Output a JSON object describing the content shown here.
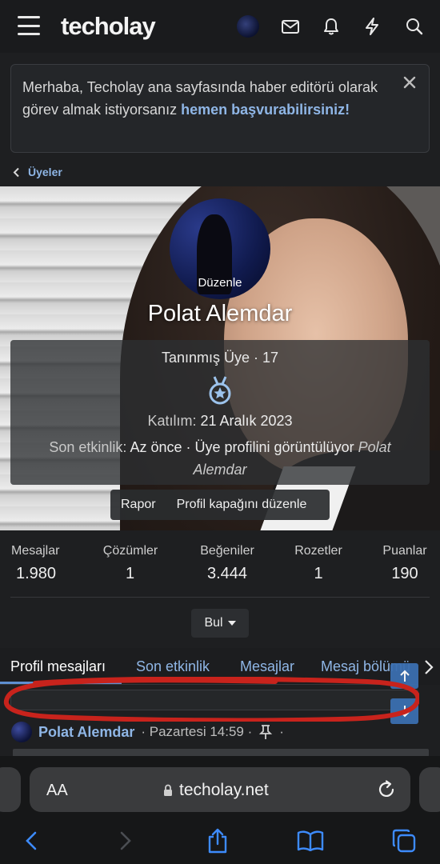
{
  "header": {
    "logo": "techolay",
    "icons": [
      "menu-icon",
      "avatar",
      "mail-icon",
      "bell-icon",
      "bolt-icon",
      "search-icon"
    ]
  },
  "notice": {
    "text": "Merhaba, Techolay ana sayfasında haber editörü olarak görev almak istiyorsanız ",
    "link": "hemen başvurabilirsiniz!"
  },
  "breadcrumb": {
    "label": "Üyeler"
  },
  "profile": {
    "avatar_edit": "Düzenle",
    "name": "Polat Alemdar",
    "title_line": "Tanınmış Üye · 17",
    "joined_label": "Katılım:",
    "joined_value": "21 Aralık 2023",
    "activity_label": "Son etkinlik:",
    "activity_value": "Az önce · Üye profilini görüntülüyor",
    "activity_target": "Polat Alemdar",
    "buttons": {
      "report": "Rapor",
      "edit_cover": "Profil kapağını düzenle"
    }
  },
  "stats": [
    {
      "label": "Mesajlar",
      "value": "1.980"
    },
    {
      "label": "Çözümler",
      "value": "1"
    },
    {
      "label": "Beğeniler",
      "value": "3.444"
    },
    {
      "label": "Rozetler",
      "value": "1"
    },
    {
      "label": "Puanlar",
      "value": "190"
    }
  ],
  "find_button": "Bul",
  "tabs": [
    {
      "label": "Profil mesajları",
      "active": true
    },
    {
      "label": "Son etkinlik",
      "active": false
    },
    {
      "label": "Mesajlar",
      "active": false
    },
    {
      "label": "Mesaj bölümü",
      "active": false
    }
  ],
  "message": {
    "author": "Polat Alemdar",
    "meta": "· Pazartesi 14:59 ·",
    "trailing": "·"
  },
  "browser": {
    "aa_label": "AA",
    "url": "techolay.net"
  },
  "colors": {
    "accent": "#8fb6e6",
    "tab_underline": "#5e8fd1",
    "annotation": "#c8231c",
    "scroll_button": "#3b6fb0"
  }
}
